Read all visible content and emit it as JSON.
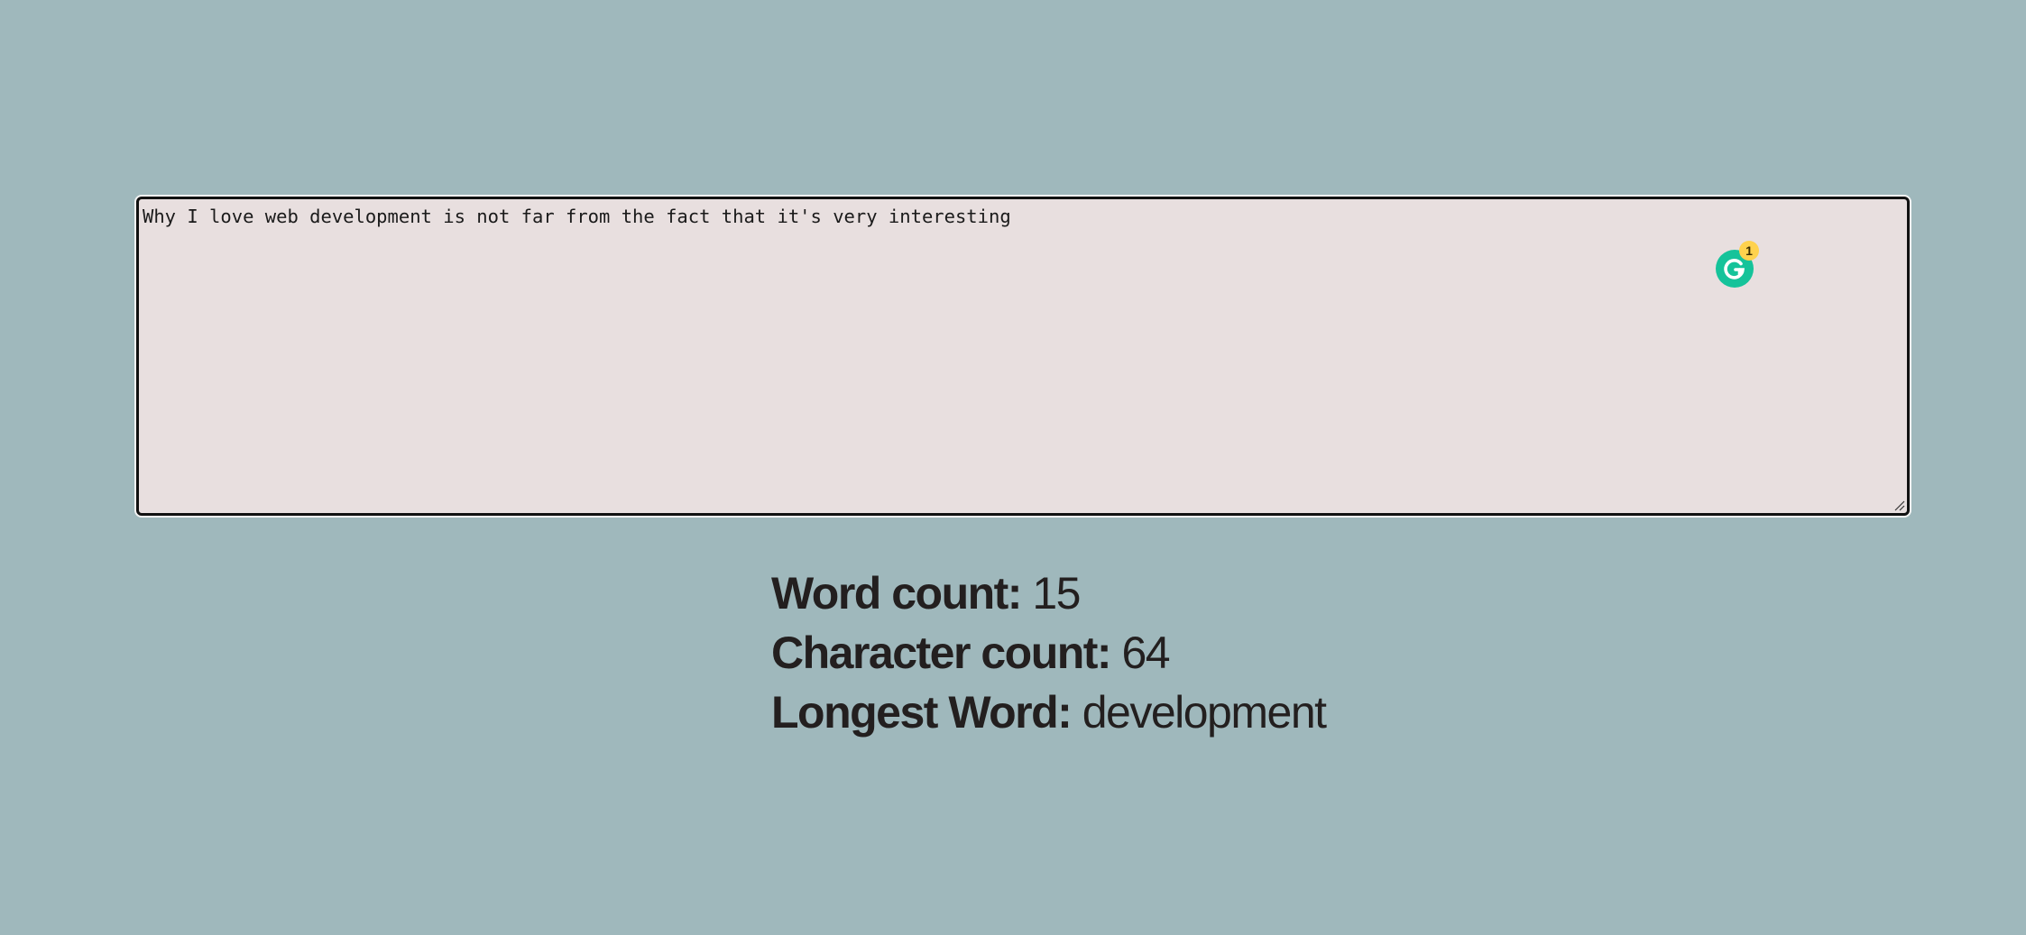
{
  "editor": {
    "text": "Why I love web development is not far from the fact that it's very interesting",
    "assistant_badge_count": "1",
    "assistant_icon": "grammarly-g-icon"
  },
  "stats": {
    "word_count_label": "Word count:",
    "word_count_value": "15",
    "character_count_label": "Character count:",
    "character_count_value": "64",
    "longest_word_label": "Longest Word:",
    "longest_word_value": "development"
  },
  "colors": {
    "background": "#9fb8bc",
    "editor_background": "#e8dfdf",
    "assistant_green": "#15c39a",
    "badge_yellow": "#ffd24d"
  }
}
